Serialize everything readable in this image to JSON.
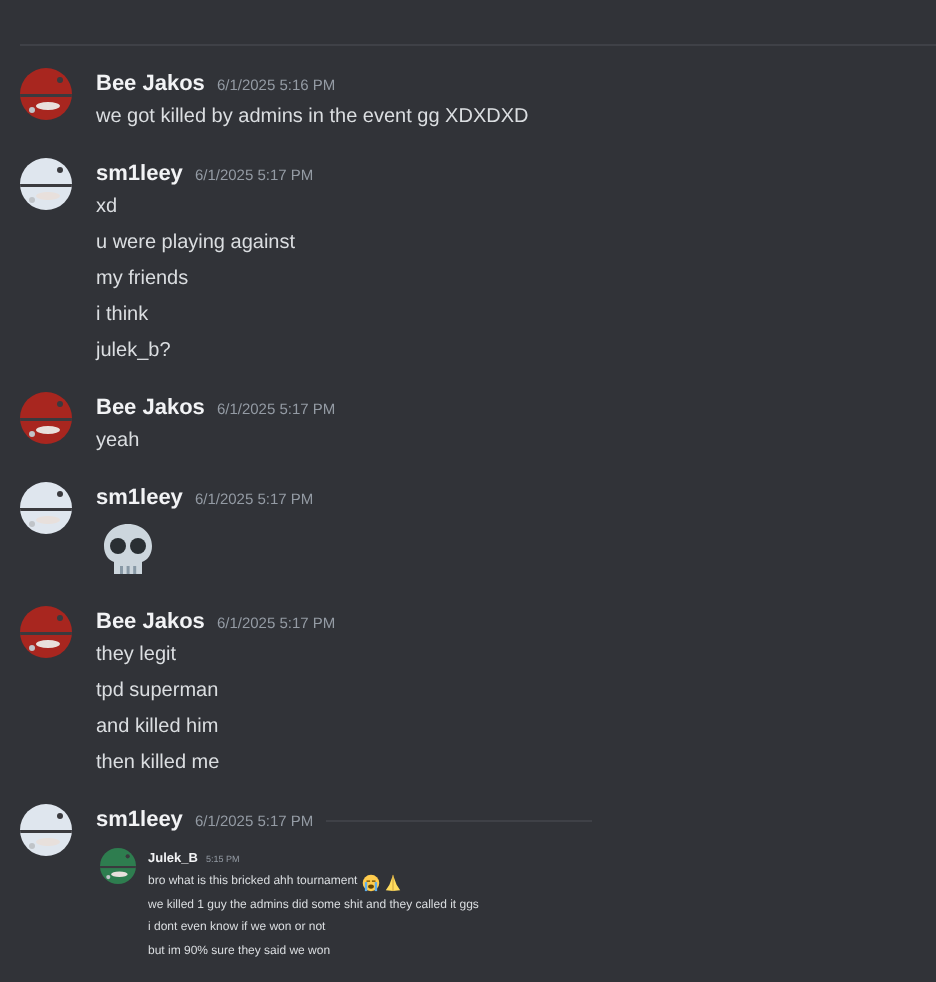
{
  "messages": [
    {
      "author": "Bee Jakos",
      "color": "#a8261f",
      "time": "6/1/2025 5:16 PM",
      "kind": "text",
      "lines": [
        "we got killed by admins in the event gg XDXDXD"
      ]
    },
    {
      "author": "sm1leey",
      "color": "#dfe6ee",
      "time": "6/1/2025 5:17 PM",
      "kind": "text",
      "lines": [
        "xd",
        "u were playing against",
        "my friends",
        "i think",
        "julek_b?"
      ]
    },
    {
      "author": "Bee Jakos",
      "color": "#a8261f",
      "time": "6/1/2025 5:17 PM",
      "kind": "text",
      "lines": [
        "yeah"
      ]
    },
    {
      "author": "sm1leey",
      "color": "#dfe6ee",
      "time": "6/1/2025 5:17 PM",
      "kind": "skull"
    },
    {
      "author": "Bee Jakos",
      "color": "#a8261f",
      "time": "6/1/2025 5:17 PM",
      "kind": "text",
      "lines": [
        "they legit",
        "tpd superman",
        "and killed him",
        "then killed me"
      ]
    },
    {
      "author": "sm1leey",
      "color": "#dfe6ee",
      "time": "6/1/2025 5:17 PM",
      "kind": "forward",
      "forward": {
        "author": "Julek_B",
        "color": "#2e7d4f",
        "time": "5:15 PM",
        "lines": [
          {
            "kind": "text_emojis",
            "text": "bro what is this bricked ahh tournament"
          },
          {
            "kind": "text",
            "text": "we killed 1 guy the admins did some shit and they called it ggs"
          },
          {
            "kind": "text",
            "text": "i dont even know if we won or not"
          },
          {
            "kind": "text",
            "text": "but im 90% sure they said we won"
          }
        ]
      }
    }
  ]
}
